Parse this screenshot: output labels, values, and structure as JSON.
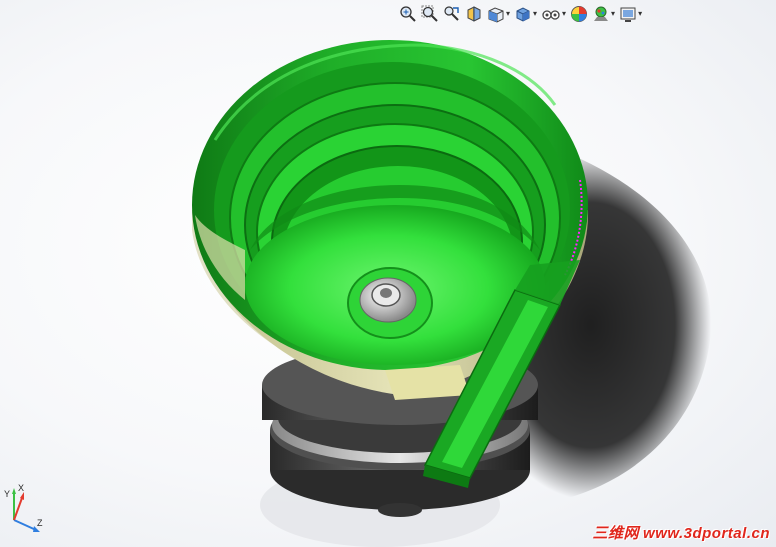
{
  "viewport": {
    "background": "#f4f6f9"
  },
  "toolbar": {
    "buttons": [
      {
        "name": "zoom-to-fit-icon",
        "dropdown": false
      },
      {
        "name": "zoom-to-area-icon",
        "dropdown": false
      },
      {
        "name": "previous-view-icon",
        "dropdown": false
      },
      {
        "name": "section-view-icon",
        "dropdown": false
      },
      {
        "name": "view-orientation-icon",
        "dropdown": true
      },
      {
        "name": "display-style-icon",
        "dropdown": true
      },
      {
        "name": "hide-show-items-icon",
        "dropdown": true
      },
      {
        "name": "edit-appearance-icon",
        "dropdown": false
      },
      {
        "name": "apply-scene-icon",
        "dropdown": true
      },
      {
        "name": "view-settings-icon",
        "dropdown": true
      }
    ]
  },
  "model": {
    "bowl_color": "#1fbf2a",
    "inner_floor_color": "#3ee848",
    "rim_band_color": "#d8d6a8",
    "base_color": "#4a4a4a",
    "chute_color": "#18b020"
  },
  "triad": {
    "x_label": "X",
    "y_label": "Y",
    "z_label": "Z"
  },
  "watermark": {
    "cn": "三维网",
    "url": "www.3dportal.cn"
  }
}
